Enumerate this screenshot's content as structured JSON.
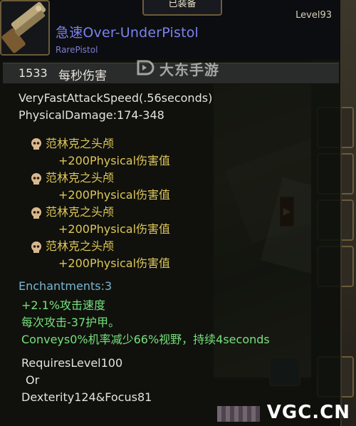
{
  "tooltip": {
    "equipped_label": "已装备",
    "level_label": "Level93",
    "item_name": "急速Over-UnderPistol",
    "item_type": "RarePistol",
    "dps_value": "1533",
    "dps_label": "每秒伤害",
    "attack_speed": "VeryFastAttackSpeed(.56seconds)",
    "physical_damage": "PhysicalDamage:174-348",
    "sockets": [
      {
        "gem": "范林克之头颅",
        "bonus": "+200Physical伤害值"
      },
      {
        "gem": "范林克之头颅",
        "bonus": "+200Physical伤害值"
      },
      {
        "gem": "范林克之头颅",
        "bonus": "+200Physical伤害值"
      },
      {
        "gem": "范林克之头颅",
        "bonus": "+200Physical伤害值"
      }
    ],
    "enchantments_label": "Enchantments:3",
    "enchantments": [
      "+2.1%攻击速度",
      "每次攻击-37护甲。",
      "Conveys0%机率减少66%视野，持续4seconds"
    ],
    "requirements": {
      "level": "RequiresLevel100",
      "or": "Or",
      "stats": "Dexterity124&Focus81"
    }
  },
  "watermarks": {
    "top_logo": "大东手游",
    "bottom_logo": "VGC.CN"
  },
  "icons": {
    "item": "pistol-icon",
    "socket": "skull-gem-icon"
  },
  "colors": {
    "item_name": "#7c82ee",
    "socket_text": "#ddc65a",
    "enchant_header": "#79b5d2",
    "enchant_lines": "#76e07e"
  }
}
